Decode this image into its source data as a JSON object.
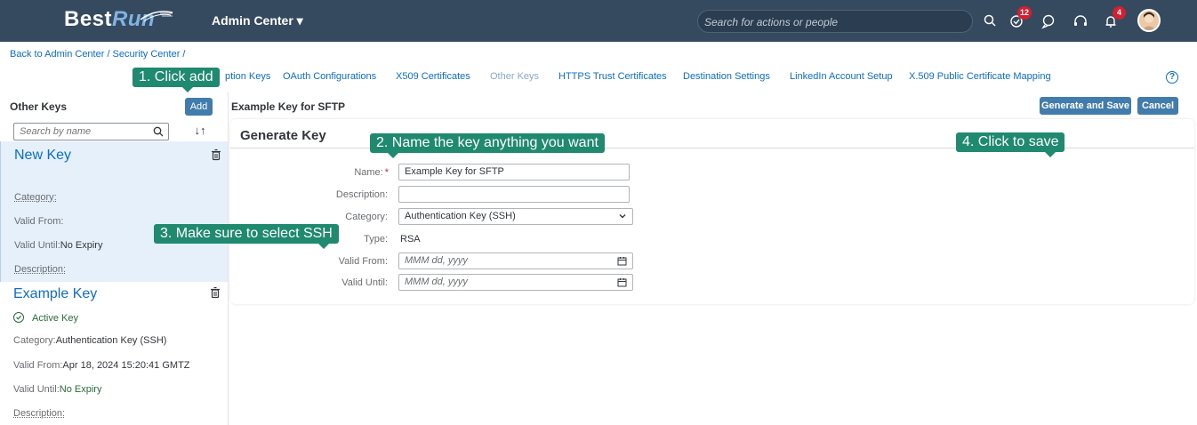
{
  "shell": {
    "logo_prefix": "Best",
    "logo_suffix": "Run",
    "app_title": "Admin Center ▾",
    "search_placeholder": "Search for actions or people",
    "todo_badge": "12",
    "notif_badge": "4"
  },
  "breadcrumb": "Back to Admin Center / Security Center /",
  "tabs": [
    "ption Keys",
    "OAuth Configurations",
    "X509 Certificates",
    "Other Keys",
    "HTTPS Trust Certificates",
    "Destination Settings",
    "LinkedIn Account Setup",
    "X.509 Public Certificate Mapping"
  ],
  "left": {
    "title": "Other Keys",
    "add_label": "Add",
    "search_placeholder": "Search by name",
    "sort_label": "↓↑",
    "items": [
      {
        "title": "New Key",
        "category_label": "Category:",
        "category_value": "",
        "valid_from_label": "Valid From:",
        "valid_from_value": "",
        "valid_until_label": "Valid Until:",
        "valid_until_value": "No Expiry",
        "description_label": "Description:"
      },
      {
        "title": "Example Key",
        "status": "Active Key",
        "category_label": "Category:",
        "category_value": "Authentication Key (SSH)",
        "valid_from_label": "Valid From:",
        "valid_from_value": "Apr 18, 2024 15:20:41 GMTZ",
        "valid_until_label": "Valid Until:",
        "valid_until_value": "No Expiry",
        "description_label": "Description:"
      }
    ]
  },
  "right": {
    "title": "Example Key for SFTP",
    "generate_label": "Generate and Save",
    "cancel_label": "Cancel",
    "card_title": "Generate Key",
    "form": {
      "name_label": "Name:",
      "name_value": "Example Key for SFTP",
      "description_label": "Description:",
      "description_value": "",
      "category_label": "Category:",
      "category_value": "Authentication Key (SSH)",
      "type_label": "Type:",
      "type_value": "RSA",
      "valid_from_label": "Valid From:",
      "valid_from_placeholder": "MMM dd, yyyy",
      "valid_until_label": "Valid Until:",
      "valid_until_placeholder": "MMM dd, yyyy"
    }
  },
  "annotations": {
    "step1": "1. Click add",
    "step2": "2. Name the key anything you want",
    "step3": "3. Make sure to select SSH",
    "step4": "4. Click to save"
  },
  "colors": {
    "shell_bg": "#354a5f",
    "link": "#0a6ed1",
    "button": "#427cac",
    "annotation": "#1f8a70",
    "selected_item_bg": "#e5f0fa",
    "positive": "#256f3a"
  }
}
